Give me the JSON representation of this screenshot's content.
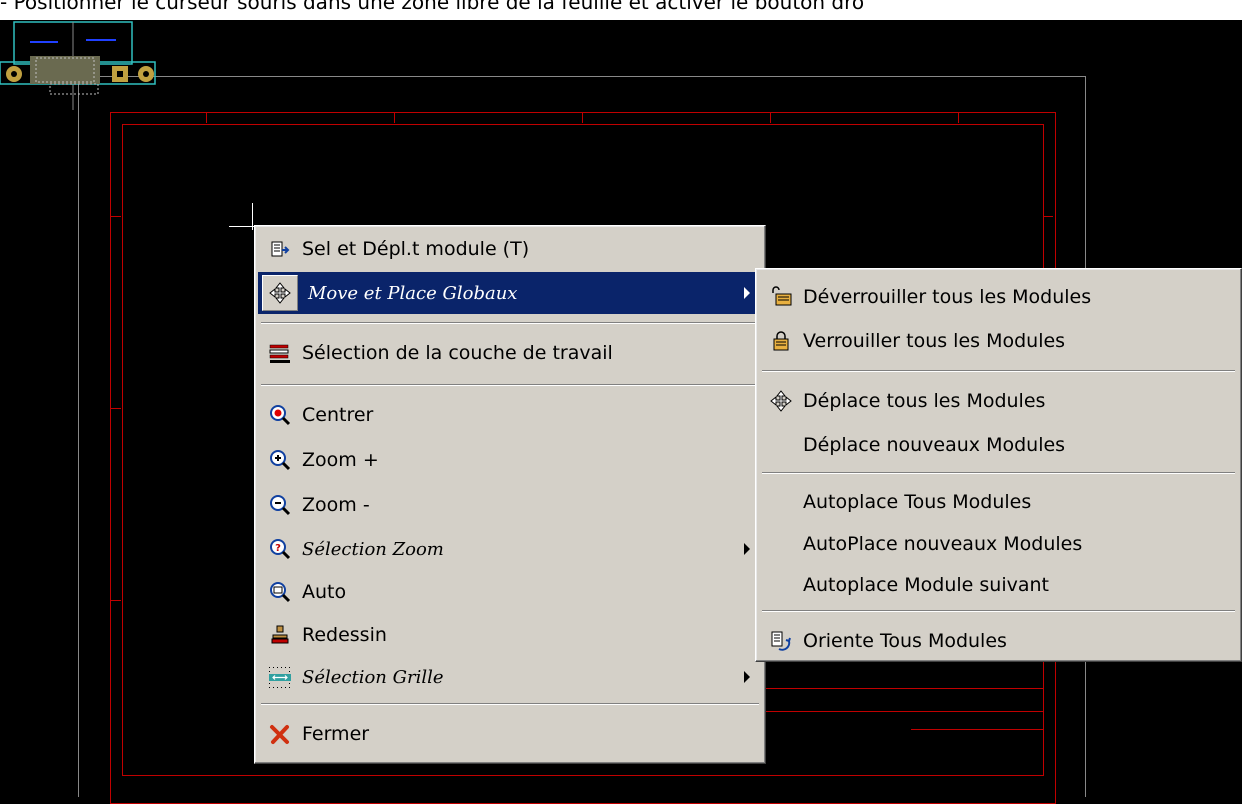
{
  "instruction": "- Positionner le curseur souris dans une zone libre de la feuille et activer le bouton dro",
  "main_menu": {
    "items": [
      {
        "label": "Sel et Dépl.t module (T)",
        "icon": "select-move-module-icon"
      },
      {
        "label": "Move et Place Globaux",
        "icon": "move-cross-icon",
        "submenu": true,
        "selected": true
      },
      {
        "label": "Sélection de la couche de travail",
        "icon": "layers-icon"
      },
      {
        "label": "Centrer",
        "icon": "center-icon"
      },
      {
        "label": "Zoom +",
        "icon": "zoom-in-icon"
      },
      {
        "label": "Zoom -",
        "icon": "zoom-out-icon"
      },
      {
        "label": "Sélection Zoom",
        "icon": "zoom-select-icon",
        "submenu": true
      },
      {
        "label": "Auto",
        "icon": "zoom-auto-icon"
      },
      {
        "label": "Redessin",
        "icon": "redraw-icon"
      },
      {
        "label": "Sélection Grille",
        "icon": "grid-icon",
        "submenu": true
      },
      {
        "label": "Fermer",
        "icon": "close-icon"
      }
    ]
  },
  "sub_menu": {
    "items": [
      {
        "label": "Déverrouiller tous les Modules",
        "icon": "unlock-icon"
      },
      {
        "label": "Verrouiller tous les Modules",
        "icon": "lock-icon"
      },
      {
        "label": "Déplace tous les Modules",
        "icon": "move-cross-icon"
      },
      {
        "label": "Déplace nouveaux Modules"
      },
      {
        "label": "Autoplace Tous Modules"
      },
      {
        "label": "AutoPlace nouveaux Modules"
      },
      {
        "label": "Autoplace Module suivant"
      },
      {
        "label": "Oriente Tous Modules",
        "icon": "rotate-modules-icon"
      }
    ]
  },
  "colors": {
    "background": "#000000",
    "frame": "#c00000",
    "menu": "#d4d0c8",
    "highlight": "#0a246a"
  }
}
